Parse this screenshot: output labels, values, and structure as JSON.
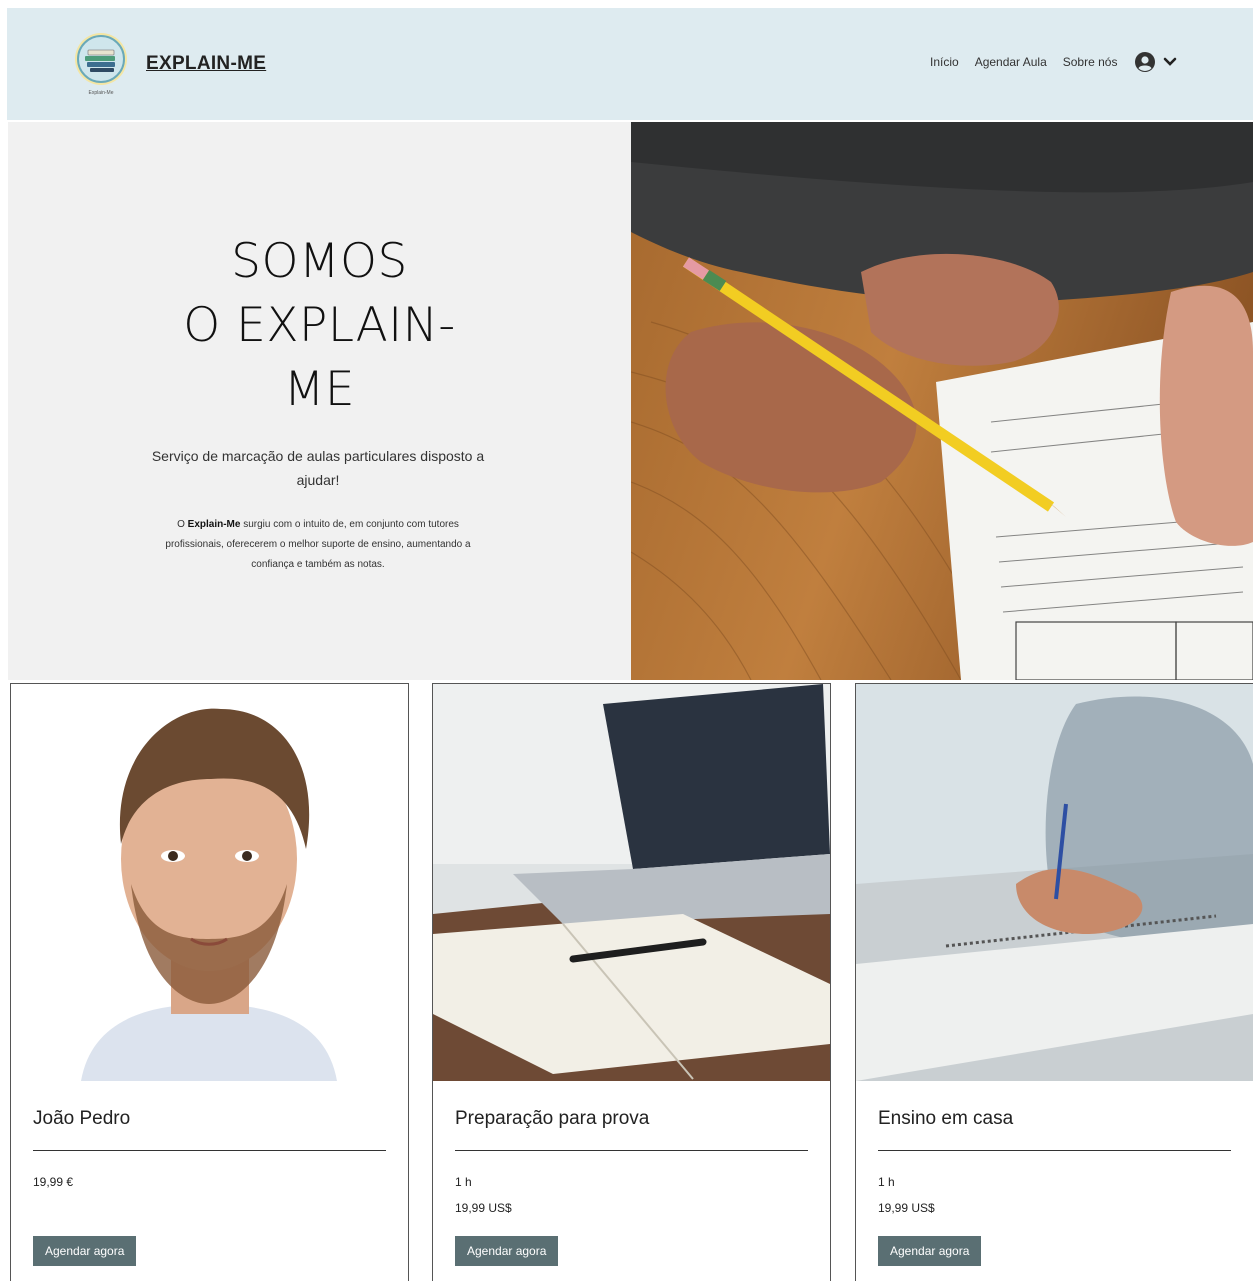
{
  "header": {
    "brand": "EXPLAIN-ME",
    "logo_caption": "Explain-Me",
    "nav": [
      "Início",
      "Agendar Aula",
      "Sobre nós"
    ]
  },
  "hero": {
    "title_lines": [
      "SOMOS",
      "O EXPLAIN-",
      "ME"
    ],
    "subtitle": "Serviço de marcação de aulas particulares disposto a ajudar!",
    "body_prefix": "O ",
    "body_bold": "Explain-Me",
    "body_rest": " surgiu com o intuito de, em conjunto com tutores profissionais, oferecerem o melhor suporte de ensino, aumentando a confiança e também as notas."
  },
  "cards": [
    {
      "name": "João Pedro",
      "duration": "",
      "price": "19,99 €",
      "button": "Agendar agora"
    },
    {
      "name": "Preparação para prova",
      "duration": "1 h",
      "price": "19,99 US$",
      "button": "Agendar agora"
    },
    {
      "name": "Ensino em casa",
      "duration": "1 h",
      "price": "19,99 US$",
      "button": "Agendar agora"
    }
  ],
  "colors": {
    "header_bg": "#deebf0",
    "hero_bg": "#f1f1f1",
    "button_bg": "#5a6f73"
  }
}
